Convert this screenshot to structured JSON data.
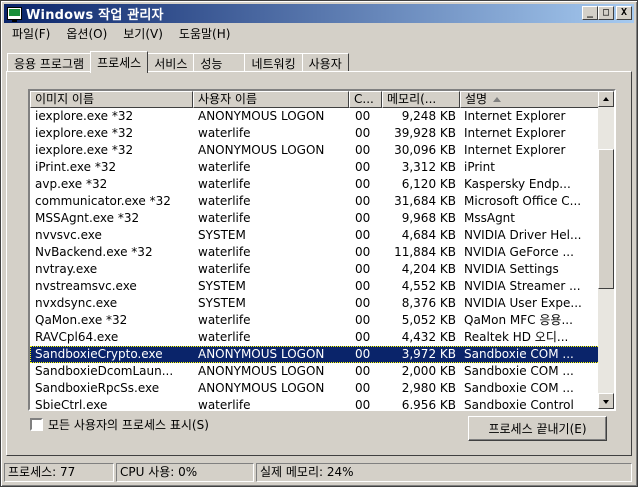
{
  "window": {
    "title": "Windows 작업 관리자"
  },
  "titlebar": {
    "minimize": "_",
    "maximize": "□",
    "close": "X"
  },
  "menu": [
    "파일(F)",
    "옵션(O)",
    "보기(V)",
    "도움말(H)"
  ],
  "tabs": [
    {
      "label": "응용 프로그램",
      "active": false
    },
    {
      "label": "프로세스",
      "active": true
    },
    {
      "label": "서비스",
      "active": false
    },
    {
      "label": "성능",
      "active": false
    },
    {
      "label": "네트워킹",
      "active": false
    },
    {
      "label": "사용자",
      "active": false
    }
  ],
  "table": {
    "columns": [
      "이미지 이름",
      "사용자 이름",
      "C...",
      "메모리(...",
      "설명"
    ],
    "rows": [
      {
        "name": "iexplore.exe *32",
        "user": "ANONYMOUS LOGON",
        "cpu": "00",
        "mem": "9,248 KB",
        "desc": "Internet Explorer"
      },
      {
        "name": "iexplore.exe *32",
        "user": "waterlife",
        "cpu": "00",
        "mem": "39,928 KB",
        "desc": "Internet Explorer"
      },
      {
        "name": "iexplore.exe *32",
        "user": "ANONYMOUS LOGON",
        "cpu": "00",
        "mem": "30,096 KB",
        "desc": "Internet Explorer"
      },
      {
        "name": "iPrint.exe *32",
        "user": "waterlife",
        "cpu": "00",
        "mem": "3,312 KB",
        "desc": "iPrint"
      },
      {
        "name": "avp.exe *32",
        "user": "waterlife",
        "cpu": "00",
        "mem": "6,120 KB",
        "desc": "Kaspersky Endp..."
      },
      {
        "name": "communicator.exe *32",
        "user": "waterlife",
        "cpu": "00",
        "mem": "31,684 KB",
        "desc": "Microsoft Office C..."
      },
      {
        "name": "MSSAgnt.exe *32",
        "user": "waterlife",
        "cpu": "00",
        "mem": "9,968 KB",
        "desc": "MssAgnt"
      },
      {
        "name": "nvvsvc.exe",
        "user": "SYSTEM",
        "cpu": "00",
        "mem": "4,684 KB",
        "desc": "NVIDIA Driver Hel..."
      },
      {
        "name": "NvBackend.exe *32",
        "user": "waterlife",
        "cpu": "00",
        "mem": "11,884 KB",
        "desc": "NVIDIA GeForce ..."
      },
      {
        "name": "nvtray.exe",
        "user": "waterlife",
        "cpu": "00",
        "mem": "4,204 KB",
        "desc": "NVIDIA Settings"
      },
      {
        "name": "nvstreamsvc.exe",
        "user": "SYSTEM",
        "cpu": "00",
        "mem": "4,552 KB",
        "desc": "NVIDIA Streamer ..."
      },
      {
        "name": "nvxdsync.exe",
        "user": "SYSTEM",
        "cpu": "00",
        "mem": "8,376 KB",
        "desc": "NVIDIA User Expe..."
      },
      {
        "name": "QaMon.exe *32",
        "user": "waterlife",
        "cpu": "00",
        "mem": "5,052 KB",
        "desc": "QaMon MFC 응용..."
      },
      {
        "name": "RAVCpl64.exe",
        "user": "waterlife",
        "cpu": "00",
        "mem": "4,432 KB",
        "desc": "Realtek HD 오디..."
      },
      {
        "name": "SandboxieCrypto.exe",
        "user": "ANONYMOUS LOGON",
        "cpu": "00",
        "mem": "3,972 KB",
        "desc": "Sandboxie COM ...",
        "selected": true
      },
      {
        "name": "SandboxieDcomLaun...",
        "user": "ANONYMOUS LOGON",
        "cpu": "00",
        "mem": "2,000 KB",
        "desc": "Sandboxie COM ..."
      },
      {
        "name": "SandboxieRpcSs.exe",
        "user": "ANONYMOUS LOGON",
        "cpu": "00",
        "mem": "2,980 KB",
        "desc": "Sandboxie COM ..."
      },
      {
        "name": "SbieCtrl.exe",
        "user": "waterlife",
        "cpu": "00",
        "mem": "6,956 KB",
        "desc": "Sandboxie Control"
      }
    ]
  },
  "show_all_users": {
    "label": "모든 사용자의 프로세스 표시(S)",
    "checked": false
  },
  "end_process_label": "프로세스 끝내기(E)",
  "status": {
    "processes": "프로세스: 77",
    "cpu": "CPU 사용: 0%",
    "memory": "실제 메모리: 24%"
  }
}
